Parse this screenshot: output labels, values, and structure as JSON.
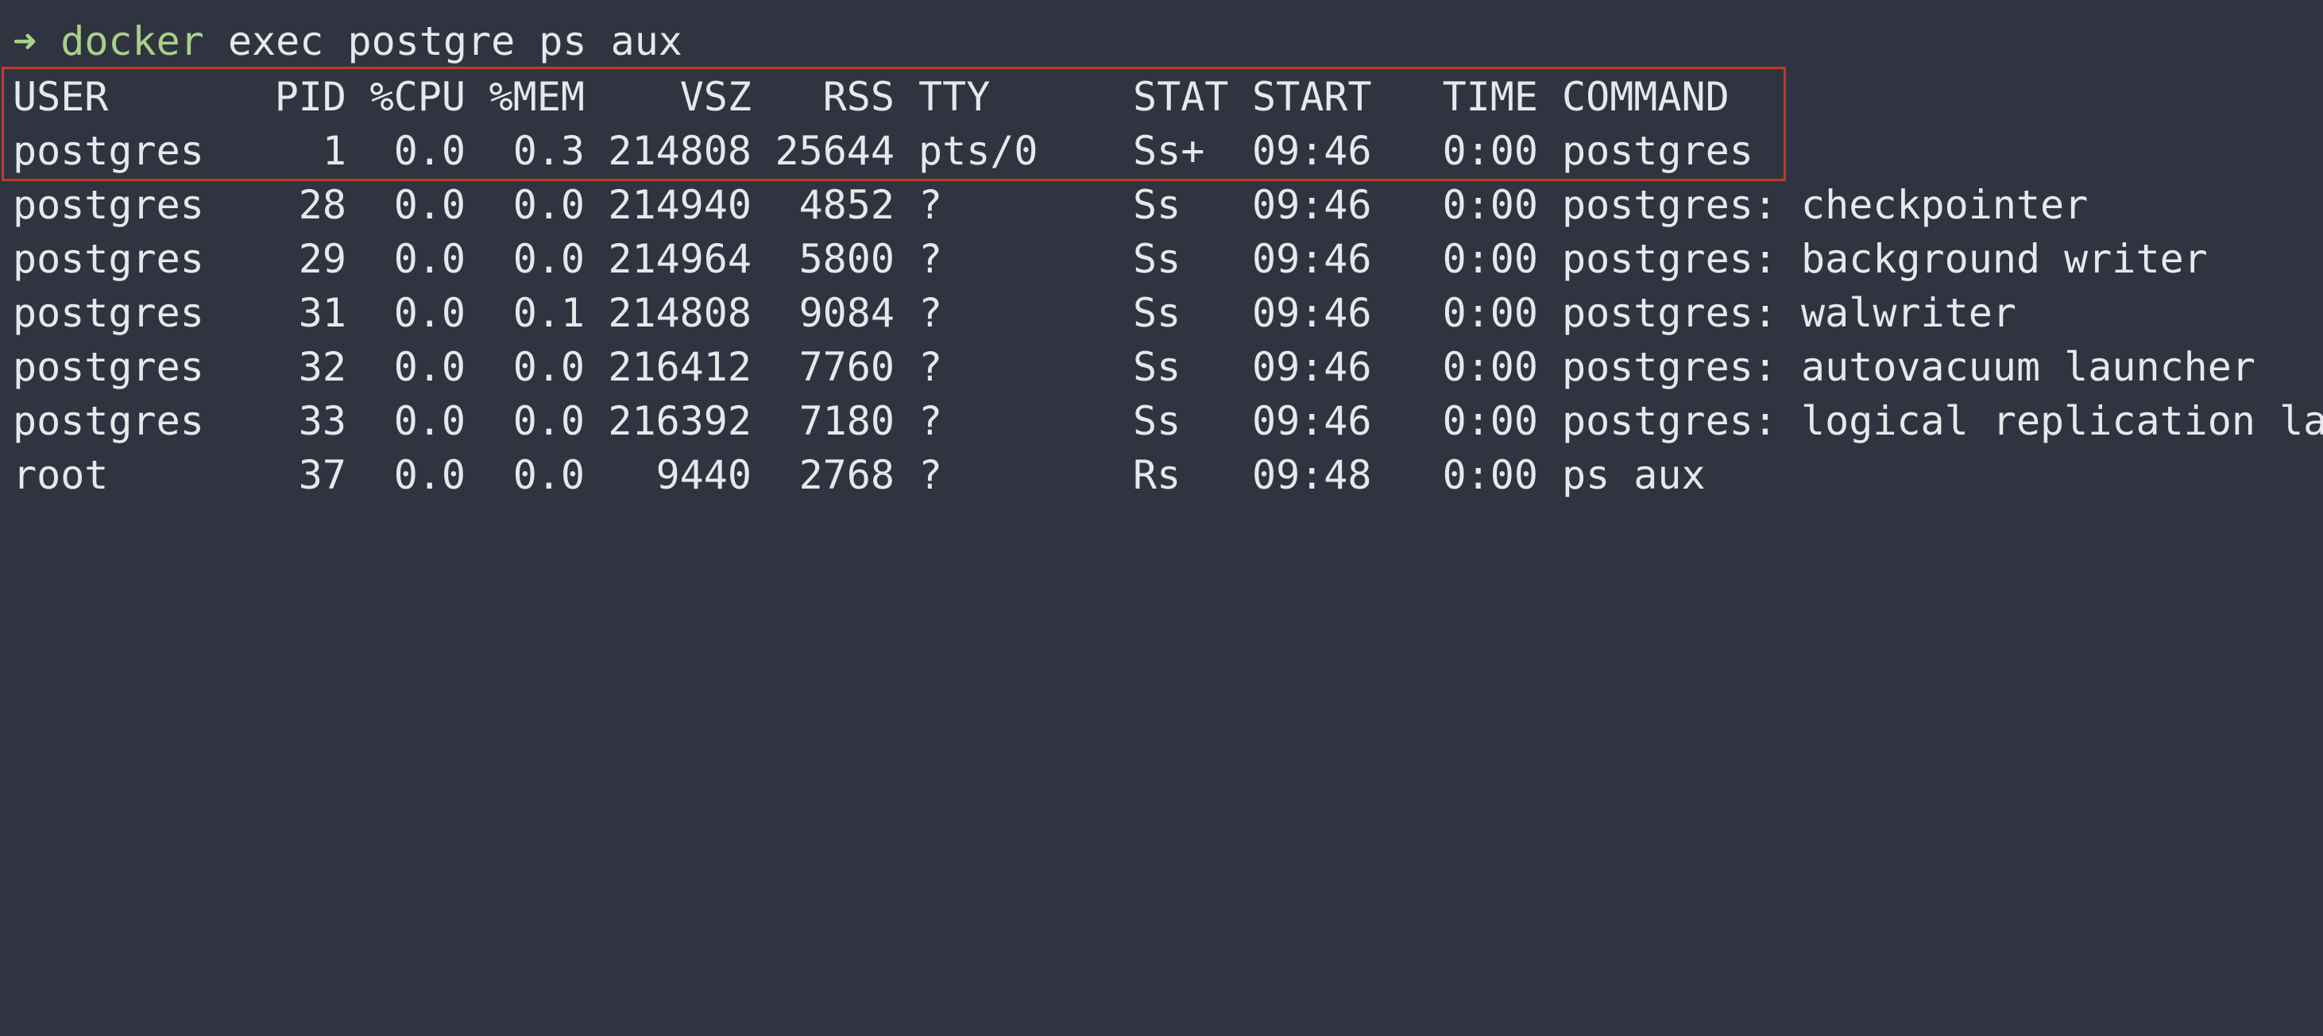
{
  "prompt": {
    "arrow": "➜",
    "command": "docker",
    "args": "exec postgre ps aux"
  },
  "table": {
    "headers": {
      "user": "USER",
      "pid": "PID",
      "cpu": "%CPU",
      "mem": "%MEM",
      "vsz": "VSZ",
      "rss": "RSS",
      "tty": "TTY",
      "stat": "STAT",
      "start": "START",
      "time": "TIME",
      "command": "COMMAND"
    },
    "rows": [
      {
        "user": "postgres",
        "pid": "1",
        "cpu": "0.0",
        "mem": "0.3",
        "vsz": "214808",
        "rss": "25644",
        "tty": "pts/0",
        "stat": "Ss+",
        "start": "09:46",
        "time": "0:00",
        "command": "postgres"
      },
      {
        "user": "postgres",
        "pid": "28",
        "cpu": "0.0",
        "mem": "0.0",
        "vsz": "214940",
        "rss": "4852",
        "tty": "?",
        "stat": "Ss",
        "start": "09:46",
        "time": "0:00",
        "command": "postgres: checkpointer"
      },
      {
        "user": "postgres",
        "pid": "29",
        "cpu": "0.0",
        "mem": "0.0",
        "vsz": "214964",
        "rss": "5800",
        "tty": "?",
        "stat": "Ss",
        "start": "09:46",
        "time": "0:00",
        "command": "postgres: background writer"
      },
      {
        "user": "postgres",
        "pid": "31",
        "cpu": "0.0",
        "mem": "0.1",
        "vsz": "214808",
        "rss": "9084",
        "tty": "?",
        "stat": "Ss",
        "start": "09:46",
        "time": "0:00",
        "command": "postgres: walwriter"
      },
      {
        "user": "postgres",
        "pid": "32",
        "cpu": "0.0",
        "mem": "0.0",
        "vsz": "216412",
        "rss": "7760",
        "tty": "?",
        "stat": "Ss",
        "start": "09:46",
        "time": "0:00",
        "command": "postgres: autovacuum launcher"
      },
      {
        "user": "postgres",
        "pid": "33",
        "cpu": "0.0",
        "mem": "0.0",
        "vsz": "216392",
        "rss": "7180",
        "tty": "?",
        "stat": "Ss",
        "start": "09:46",
        "time": "0:00",
        "command": "postgres: logical replication la"
      },
      {
        "user": "root",
        "pid": "37",
        "cpu": "0.0",
        "mem": "0.0",
        "vsz": "9440",
        "rss": "2768",
        "tty": "?",
        "stat": "Rs",
        "start": "09:48",
        "time": "0:00",
        "command": "ps aux"
      }
    ]
  },
  "colors": {
    "background": "#2f3440",
    "text": "#e6e8ec",
    "prompt": "#a9d089",
    "highlight": "#c0392b"
  }
}
